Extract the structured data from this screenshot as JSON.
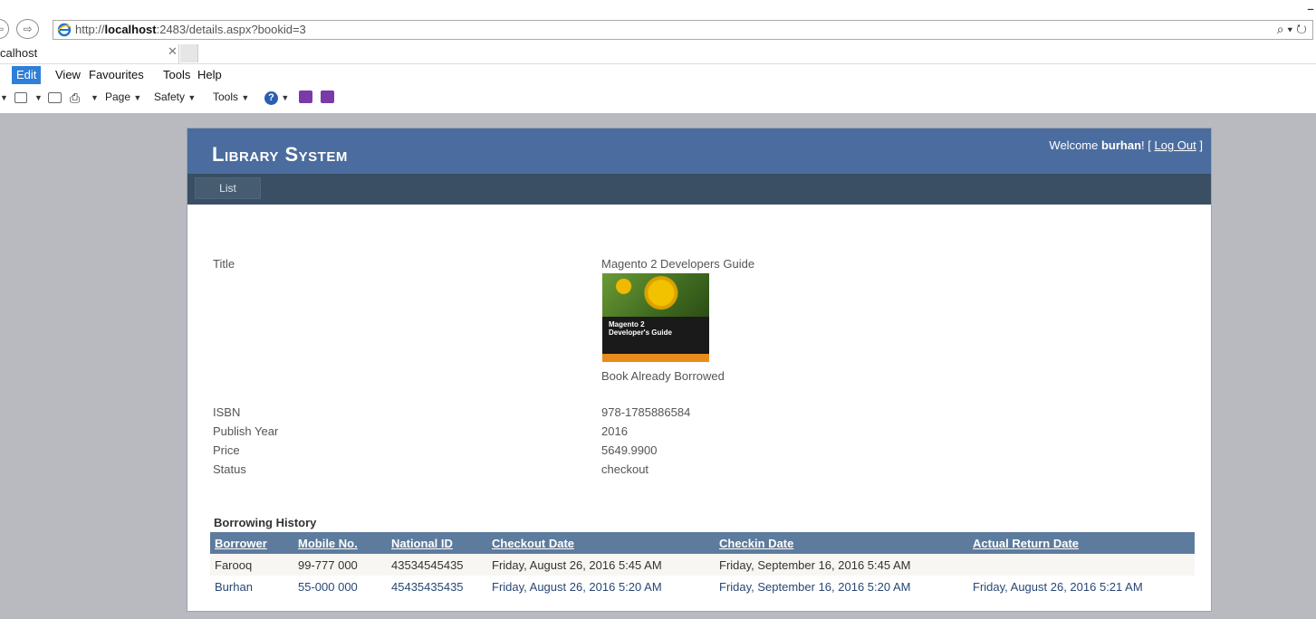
{
  "browser": {
    "url_prefix": "http://",
    "url_host": "localhost",
    "url_rest": ":2483/details.aspx?bookid=3",
    "search_glyph": "⌕ ▾ ↻",
    "tab_label": "calhost",
    "menu": [
      "Edit",
      "View",
      "Favourites",
      "Tools",
      "Help"
    ],
    "commands": {
      "page": "Page",
      "safety": "Safety",
      "tools": "Tools"
    }
  },
  "site": {
    "title": "Library System",
    "welcome": "Welcome ",
    "username": "burhan",
    "welcome_tail": "! [ ",
    "logout": "Log Out",
    "close_bracket": " ]",
    "nav": [
      "List"
    ]
  },
  "book": {
    "title_label": "Title",
    "title_value": "Magento 2 Developers Guide",
    "cover_line1": "Magento 2",
    "cover_line2": "Developer's Guide",
    "borrow_status": "Book Already Borrowed",
    "isbn_label": "ISBN",
    "isbn_value": "978-1785886584",
    "year_label": "Publish Year",
    "year_value": "2016",
    "price_label": "Price",
    "price_value": "5649.9900",
    "status_label": "Status",
    "status_value": "checkout"
  },
  "history": {
    "title": "Borrowing History",
    "columns": [
      "Borrower",
      "Mobile No.",
      "National ID",
      "Checkout Date",
      "Checkin Date",
      "Actual Return Date"
    ],
    "rows": [
      [
        "Farooq",
        "99-777 000",
        "43534545435",
        "Friday, August 26, 2016 5:45 AM",
        "Friday, September 16, 2016 5:45 AM",
        ""
      ],
      [
        "Burhan",
        "55-000 000",
        "45435435435",
        "Friday, August 26, 2016 5:20 AM",
        "Friday, September 16, 2016 5:20 AM",
        "Friday, August 26, 2016 5:21 AM"
      ]
    ]
  },
  "colors": {
    "header": "#4b6c9e",
    "navbar": "#3a4f63",
    "grid_header": "#5d7b9d",
    "link_row": "#284775"
  }
}
